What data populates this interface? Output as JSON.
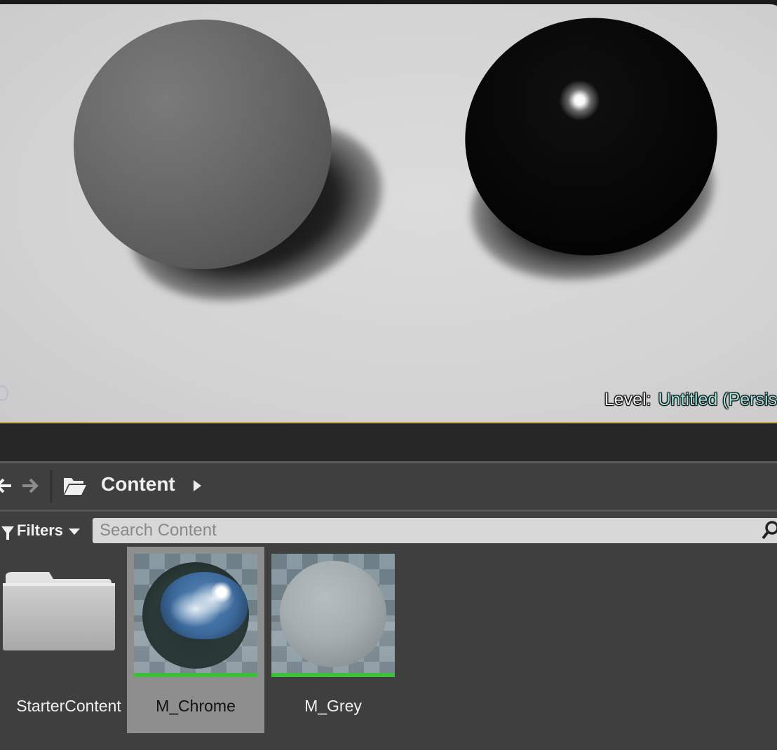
{
  "viewport": {
    "level_label": "Level:",
    "level_value": "Untitled (Persis"
  },
  "content_browser": {
    "breadcrumb": {
      "label": "Content"
    },
    "filters_label": "Filters",
    "search": {
      "placeholder": "Search Content",
      "value": ""
    },
    "assets": [
      {
        "name": "StarterContent",
        "type": "folder",
        "selected": false
      },
      {
        "name": "M_Chrome",
        "type": "material",
        "selected": true
      },
      {
        "name": "M_Grey",
        "type": "material",
        "selected": false
      }
    ]
  },
  "colors": {
    "viewport_background": "#d3d3d3",
    "level_value": "#9fe3e0",
    "selection": "#8e8e8e",
    "asset_bar": "#3dbf3d",
    "panel_background": "#3f3f3f"
  },
  "icons": [
    "back-arrow-icon",
    "forward-arrow-icon",
    "folder-open-icon",
    "chevron-right-icon",
    "filter-icon",
    "chevron-down-icon",
    "search-icon",
    "folder-icon"
  ]
}
